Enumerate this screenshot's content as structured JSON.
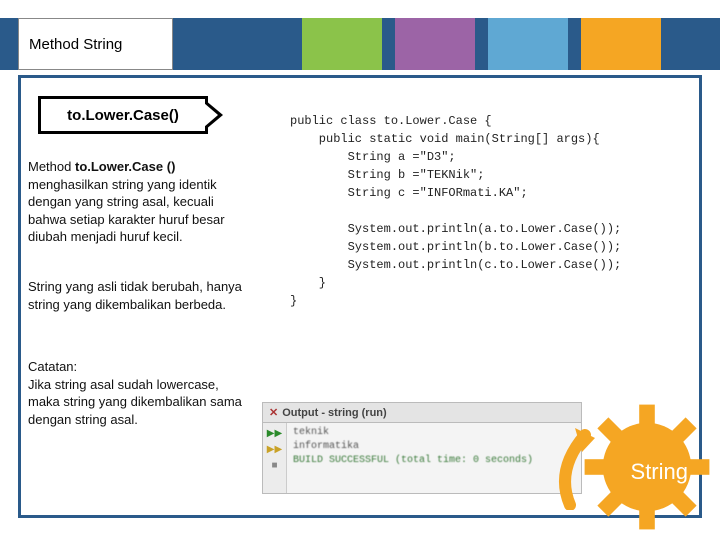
{
  "title": "Method String",
  "method_name": "to.Lower.Case()",
  "paragraphs": {
    "p1_prefix": "Method ",
    "p1_bold": "to.Lower.Case ()",
    "p1_rest": " menghasilkan string yang identik dengan yang string asal, kecuali bahwa setiap karakter huruf besar diubah menjadi huruf kecil.",
    "p2": "String yang asli tidak berubah, hanya string yang dikembalikan berbeda.",
    "p3": "Catatan:\nJika string asal sudah lowercase, maka string yang dikembalikan sama dengan string asal."
  },
  "code": "public class to.Lower.Case {\n    public static void main(String[] args){\n        String a =\"D3\";\n        String b =\"TEKNik\";\n        String c =\"INFORmati.KA\";\n\n        System.out.println(a.to.Lower.Case());\n        System.out.println(b.to.Lower.Case());\n        System.out.println(c.to.Lower.Case());\n    }\n}",
  "output": {
    "header": "Output - string (run)",
    "lines": [
      "teknik",
      "informatika"
    ],
    "build": "BUILD SUCCESSFUL (total time: 0 seconds)"
  },
  "gear_label": "String"
}
